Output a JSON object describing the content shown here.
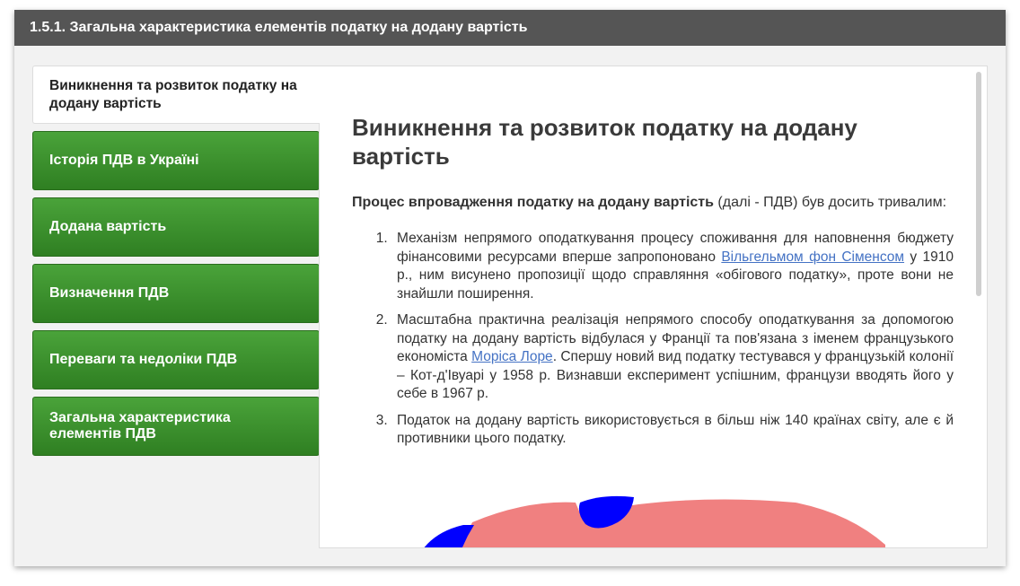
{
  "header": {
    "title": "1.5.1. Загальна характеристика елементів податку на додану вартість"
  },
  "tabs": [
    {
      "label": "Виникнення та розвиток податку на додану вартість",
      "active": true
    },
    {
      "label": "Історія ПДВ в Україні",
      "active": false
    },
    {
      "label": "Додана вартість",
      "active": false
    },
    {
      "label": "Визначення ПДВ",
      "active": false
    },
    {
      "label": "Переваги та недоліки ПДВ",
      "active": false
    },
    {
      "label": "Загальна характеристика елементів ПДВ",
      "active": false
    }
  ],
  "content": {
    "heading": "Виникнення та розвиток податку на додану вартість",
    "intro_bold": "Процес впровадження податку на додану вартість",
    "intro_rest": " (далі - ПДВ) був досить тривалим:",
    "items": [
      {
        "before": "Механізм непрямого оподаткування процесу споживання для наповнення бюджету фінансовими ресурсами вперше запропоновано ",
        "link": "Вільгельмом фон Сіменсом",
        "after": " у 1910 р., ним висунено пропозиції щодо справляння «обігового податку», проте вони не знайшли поширення."
      },
      {
        "before": "Масштабна практична реалізація непрямого способу оподаткування за допомогою податку на додану вартість відбулася у Франції та пов'язана з іменем французького економіста ",
        "link": "Моріса Лоре",
        "after": ". Спершу новий вид податку тестувався у французькій колонії – Кот-д'Івуарі у 1958 р. Визнавши експеримент успішним, французи вводять його у себе в 1967 р."
      },
      {
        "before": "Податок на додану вартість використовується в більш ніж 140 країнах світу, але є й противники цього податку.",
        "link": "",
        "after": ""
      }
    ]
  },
  "colors": {
    "tab_green": "#3a8f2c",
    "header_gray": "#555555",
    "link_blue": "#4472c4",
    "map_vat": "#f08080",
    "map_no_vat": "#0000ff"
  }
}
